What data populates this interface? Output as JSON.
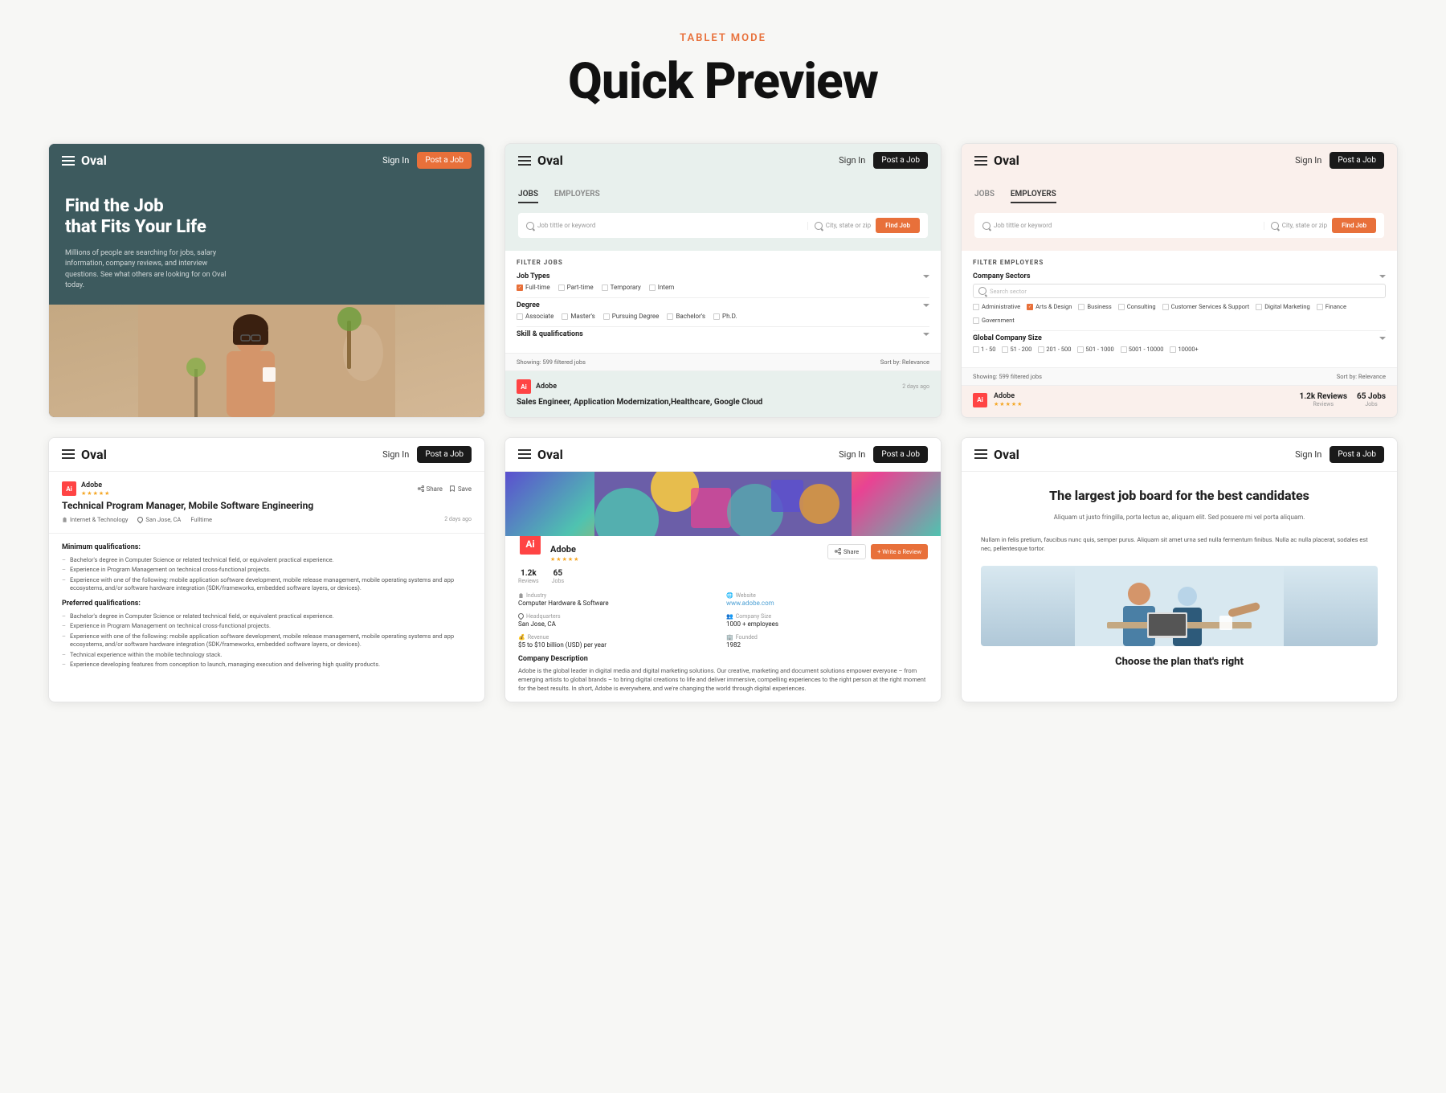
{
  "header": {
    "tablet_mode": "TABLET MODE",
    "title": "Quick Preview"
  },
  "nav": {
    "logo": "Oval",
    "sign_in": "Sign In",
    "post_job": "Post a Job"
  },
  "card1": {
    "hero_title": "Find the Job\nthat Fits Your Life",
    "hero_desc": "Millions of people are searching for jobs, salary information, company reviews, and interview questions. See what others are looking for on Oval today."
  },
  "card2": {
    "tabs": [
      "JOBS",
      "EMPLOYERS"
    ],
    "active_tab": "JOBS",
    "search_placeholder": "Job tittle or keyword",
    "location_placeholder": "City, state or zip",
    "find_job_btn": "Find Job",
    "filter_label": "FILTER JOBS",
    "job_types_label": "Job Types",
    "job_types": [
      "Full-time",
      "Part-time",
      "Temporary",
      "Intern"
    ],
    "degree_label": "Degree",
    "degrees": [
      "Associate",
      "Master's",
      "Pursuing Degree",
      "Bachelor's",
      "Ph.D."
    ],
    "skills_label": "Skill & qualifications",
    "showing": "Showing: 599 filtered jobs",
    "sort": "Sort by: Relevance",
    "company": "Adobe",
    "post_date": "2 days ago",
    "job_title": "Sales Engineer, Application Modernization,Healthcare, Google Cloud"
  },
  "card3": {
    "tabs": [
      "JOBS",
      "EMPLOYERS"
    ],
    "active_tab": "EMPLOYERS",
    "search_placeholder": "Job tittle or keyword",
    "location_placeholder": "City, state or zip",
    "find_job_btn": "Find Job",
    "filter_label": "FILTER EMPLOYERS",
    "company_sectors_label": "Company Sectors",
    "sectors": [
      "Administrative",
      "Arts & Design",
      "Business",
      "Consulting",
      "Customer Services & Support",
      "Digital Marketing",
      "Finance",
      "Government"
    ],
    "checked_sectors": [
      "Arts & Design"
    ],
    "size_label": "Global Company Size",
    "sizes": [
      "1 - 50",
      "51 - 200",
      "201 - 500",
      "501 - 1000",
      "5001 - 10000",
      "10000+"
    ],
    "showing": "Showing: 599 filtered jobs",
    "sort": "Sort by: Relevance",
    "company": "Adobe",
    "reviews": "1.2k\nReviews",
    "jobs": "65\nJobs"
  },
  "card4": {
    "company": "Adobe",
    "rating": "4.8",
    "share": "Share",
    "save": "Save",
    "job_title": "Technical Program Manager, Mobile Software Engineering",
    "industry": "Internet & Technology",
    "location": "San Jose, CA",
    "type": "Fulltime",
    "posted": "2 days ago",
    "min_qual_title": "Minimum qualifications:",
    "min_quals": [
      "Bachelor's degree in Computer Science or related technical field, or equivalent practical experience.",
      "Experience in Program Management on technical cross-functional projects.",
      "Experience with one of the following: mobile application software development, mobile release management, mobile operating systems and app ecosystems, and/or software hardware integration (SDK/frameworks, embedded software layers, or devices)."
    ],
    "pref_qual_title": "Preferred qualifications:",
    "pref_quals": [
      "Bachelor's degree in Computer Science or related technical field, or equivalent practical experience.",
      "Experience in Program Management on technical cross-functional projects.",
      "Experience with one of the following: mobile application software development, mobile release management, mobile operating systems and app ecosystems, and/or software hardware integration (SDK/frameworks, embedded software layers, or devices).",
      "Technical experience within the mobile technology stack.",
      "Experience developing features from conception to launch, managing execution and delivering high quality products."
    ]
  },
  "card5": {
    "company": "Adobe",
    "rating": "4.8",
    "reviews": "1.2k",
    "reviews_label": "Reviews",
    "jobs": "65",
    "jobs_label": "Jobs",
    "share": "Share",
    "write_review": "+ Write a Review",
    "industry_label": "Industry",
    "industry": "Computer Hardware & Software",
    "website_label": "Website",
    "website": "www.adobe.com",
    "hq_label": "Headquarters",
    "hq": "San Jose, CA",
    "size_label": "Company Size",
    "size": "1000 + employees",
    "revenue_label": "Revenue",
    "revenue": "$5 to $10 billion (USD) per year",
    "founded_label": "Founded",
    "founded": "1982",
    "desc_title": "Company Description",
    "desc": "Adobe is the global leader in digital media and digital marketing solutions. Our creative, marketing and document solutions empower everyone – from emerging artists to global brands – to bring digital creations to life and deliver immersive, compelling experiences to the right person at the right moment for the best results. In short, Adobe is everywhere, and we're changing the world through digital experiences."
  },
  "card6": {
    "title": "The largest job board for the best candidates",
    "desc1": "Aliquam ut justo fringilla, porta lectus ac, aliquam elit. Sed posuere mi vel porta aliquam.",
    "desc2": "Nullam in felis pretium, faucibus nunc quis, semper purus. Aliquam sit amet urna sed nulla fermentum finibus. Nulla ac nulla placerat, sodales est nec, pellentesque tortor.",
    "choose_plan": "Choose the plan that's right"
  }
}
